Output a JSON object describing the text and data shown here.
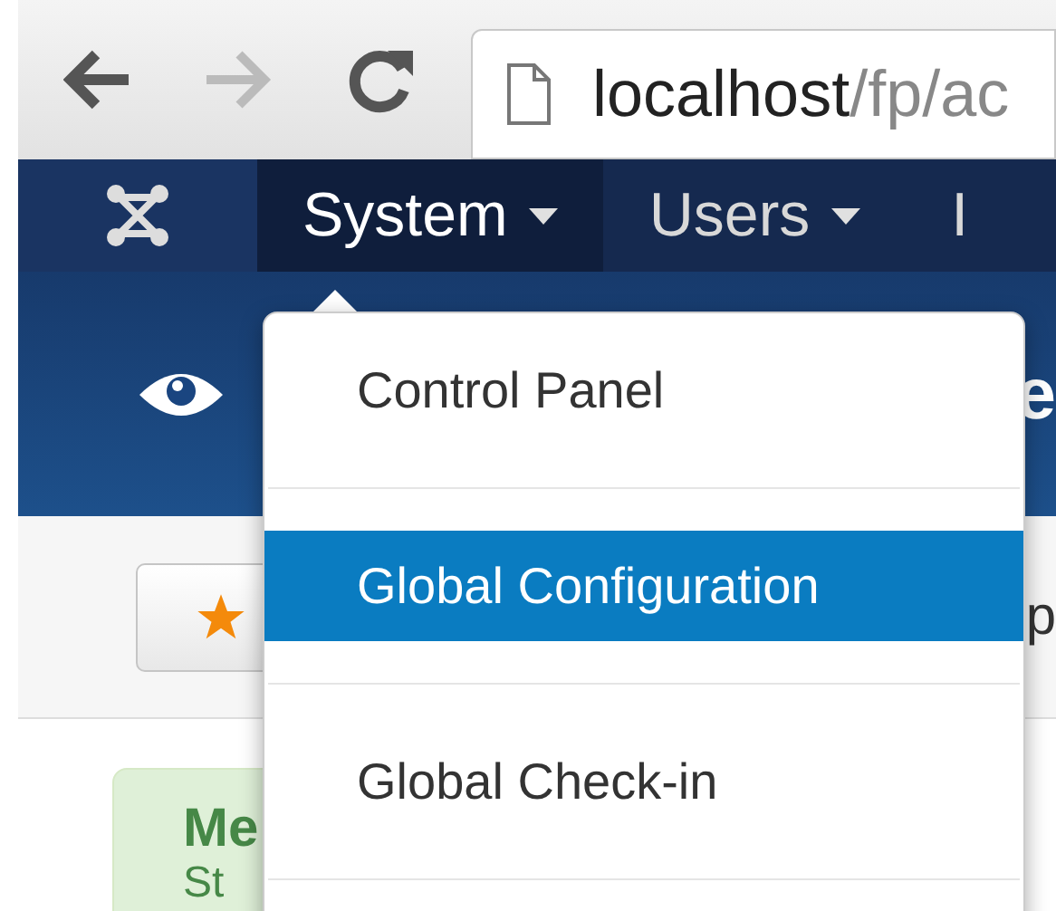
{
  "browser": {
    "address_host": "localhost",
    "address_path": "/fp/ac"
  },
  "nav": {
    "items": [
      {
        "label": "System",
        "selected": true,
        "caret": true
      },
      {
        "label": "Users",
        "selected": false,
        "caret": true
      },
      {
        "label": "I",
        "selected": false,
        "caret": false
      }
    ]
  },
  "header": {
    "title": "e"
  },
  "toolbar": {
    "button_text": "p"
  },
  "message": {
    "heading": "Me",
    "text": "St"
  },
  "dropdown": {
    "items": [
      {
        "label": "Control Panel",
        "selected": false
      },
      {
        "label": "Global Configuration",
        "selected": true
      },
      {
        "label": "Global Check-in",
        "selected": false
      }
    ]
  }
}
